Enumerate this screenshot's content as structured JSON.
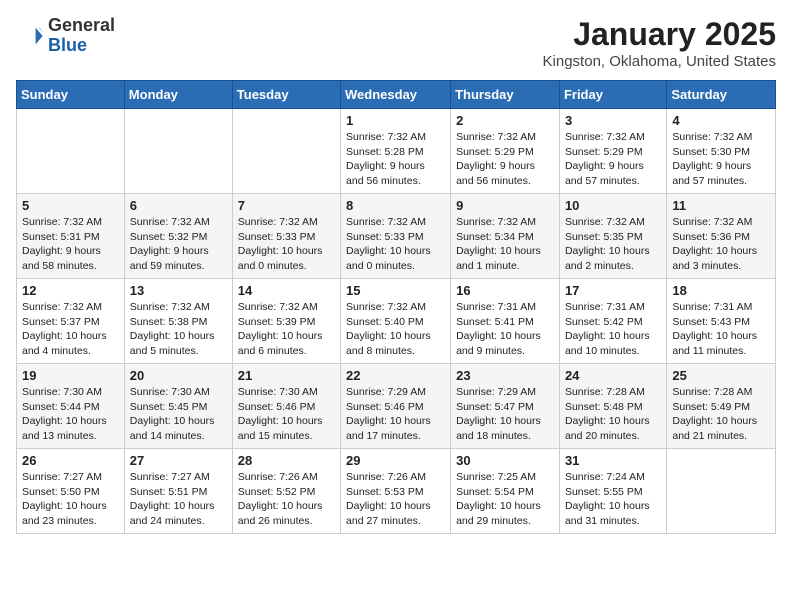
{
  "header": {
    "logo_general": "General",
    "logo_blue": "Blue",
    "title": "January 2025",
    "subtitle": "Kingston, Oklahoma, United States"
  },
  "days_of_week": [
    "Sunday",
    "Monday",
    "Tuesday",
    "Wednesday",
    "Thursday",
    "Friday",
    "Saturday"
  ],
  "weeks": [
    [
      {
        "day": "",
        "info": ""
      },
      {
        "day": "",
        "info": ""
      },
      {
        "day": "",
        "info": ""
      },
      {
        "day": "1",
        "info": "Sunrise: 7:32 AM\nSunset: 5:28 PM\nDaylight: 9 hours\nand 56 minutes."
      },
      {
        "day": "2",
        "info": "Sunrise: 7:32 AM\nSunset: 5:29 PM\nDaylight: 9 hours\nand 56 minutes."
      },
      {
        "day": "3",
        "info": "Sunrise: 7:32 AM\nSunset: 5:29 PM\nDaylight: 9 hours\nand 57 minutes."
      },
      {
        "day": "4",
        "info": "Sunrise: 7:32 AM\nSunset: 5:30 PM\nDaylight: 9 hours\nand 57 minutes."
      }
    ],
    [
      {
        "day": "5",
        "info": "Sunrise: 7:32 AM\nSunset: 5:31 PM\nDaylight: 9 hours\nand 58 minutes."
      },
      {
        "day": "6",
        "info": "Sunrise: 7:32 AM\nSunset: 5:32 PM\nDaylight: 9 hours\nand 59 minutes."
      },
      {
        "day": "7",
        "info": "Sunrise: 7:32 AM\nSunset: 5:33 PM\nDaylight: 10 hours\nand 0 minutes."
      },
      {
        "day": "8",
        "info": "Sunrise: 7:32 AM\nSunset: 5:33 PM\nDaylight: 10 hours\nand 0 minutes."
      },
      {
        "day": "9",
        "info": "Sunrise: 7:32 AM\nSunset: 5:34 PM\nDaylight: 10 hours\nand 1 minute."
      },
      {
        "day": "10",
        "info": "Sunrise: 7:32 AM\nSunset: 5:35 PM\nDaylight: 10 hours\nand 2 minutes."
      },
      {
        "day": "11",
        "info": "Sunrise: 7:32 AM\nSunset: 5:36 PM\nDaylight: 10 hours\nand 3 minutes."
      }
    ],
    [
      {
        "day": "12",
        "info": "Sunrise: 7:32 AM\nSunset: 5:37 PM\nDaylight: 10 hours\nand 4 minutes."
      },
      {
        "day": "13",
        "info": "Sunrise: 7:32 AM\nSunset: 5:38 PM\nDaylight: 10 hours\nand 5 minutes."
      },
      {
        "day": "14",
        "info": "Sunrise: 7:32 AM\nSunset: 5:39 PM\nDaylight: 10 hours\nand 6 minutes."
      },
      {
        "day": "15",
        "info": "Sunrise: 7:32 AM\nSunset: 5:40 PM\nDaylight: 10 hours\nand 8 minutes."
      },
      {
        "day": "16",
        "info": "Sunrise: 7:31 AM\nSunset: 5:41 PM\nDaylight: 10 hours\nand 9 minutes."
      },
      {
        "day": "17",
        "info": "Sunrise: 7:31 AM\nSunset: 5:42 PM\nDaylight: 10 hours\nand 10 minutes."
      },
      {
        "day": "18",
        "info": "Sunrise: 7:31 AM\nSunset: 5:43 PM\nDaylight: 10 hours\nand 11 minutes."
      }
    ],
    [
      {
        "day": "19",
        "info": "Sunrise: 7:30 AM\nSunset: 5:44 PM\nDaylight: 10 hours\nand 13 minutes."
      },
      {
        "day": "20",
        "info": "Sunrise: 7:30 AM\nSunset: 5:45 PM\nDaylight: 10 hours\nand 14 minutes."
      },
      {
        "day": "21",
        "info": "Sunrise: 7:30 AM\nSunset: 5:46 PM\nDaylight: 10 hours\nand 15 minutes."
      },
      {
        "day": "22",
        "info": "Sunrise: 7:29 AM\nSunset: 5:46 PM\nDaylight: 10 hours\nand 17 minutes."
      },
      {
        "day": "23",
        "info": "Sunrise: 7:29 AM\nSunset: 5:47 PM\nDaylight: 10 hours\nand 18 minutes."
      },
      {
        "day": "24",
        "info": "Sunrise: 7:28 AM\nSunset: 5:48 PM\nDaylight: 10 hours\nand 20 minutes."
      },
      {
        "day": "25",
        "info": "Sunrise: 7:28 AM\nSunset: 5:49 PM\nDaylight: 10 hours\nand 21 minutes."
      }
    ],
    [
      {
        "day": "26",
        "info": "Sunrise: 7:27 AM\nSunset: 5:50 PM\nDaylight: 10 hours\nand 23 minutes."
      },
      {
        "day": "27",
        "info": "Sunrise: 7:27 AM\nSunset: 5:51 PM\nDaylight: 10 hours\nand 24 minutes."
      },
      {
        "day": "28",
        "info": "Sunrise: 7:26 AM\nSunset: 5:52 PM\nDaylight: 10 hours\nand 26 minutes."
      },
      {
        "day": "29",
        "info": "Sunrise: 7:26 AM\nSunset: 5:53 PM\nDaylight: 10 hours\nand 27 minutes."
      },
      {
        "day": "30",
        "info": "Sunrise: 7:25 AM\nSunset: 5:54 PM\nDaylight: 10 hours\nand 29 minutes."
      },
      {
        "day": "31",
        "info": "Sunrise: 7:24 AM\nSunset: 5:55 PM\nDaylight: 10 hours\nand 31 minutes."
      },
      {
        "day": "",
        "info": ""
      }
    ]
  ]
}
